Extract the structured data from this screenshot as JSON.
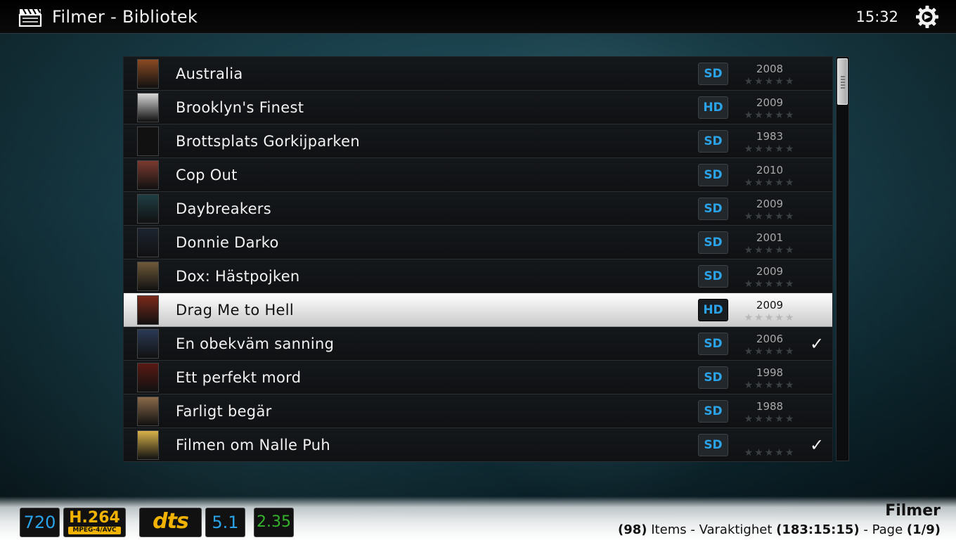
{
  "header": {
    "title": "Filmer - Bibliotek",
    "clock": "15:32",
    "icons": {
      "app": "clapperboard-icon",
      "settings": "gear-icon"
    }
  },
  "list": {
    "selected_index": 7,
    "items": [
      {
        "title": "Australia",
        "resolution": "SD",
        "year": "2008",
        "rating_stars": 0,
        "watched": false,
        "poster_color": "#8a4a22"
      },
      {
        "title": "Brooklyn's Finest",
        "resolution": "HD",
        "year": "2009",
        "rating_stars": 0,
        "watched": false,
        "poster_color": "#d8d8d8"
      },
      {
        "title": "Brottsplats Gorkijparken",
        "resolution": "SD",
        "year": "1983",
        "rating_stars": 0,
        "watched": false,
        "poster_color": "#111111"
      },
      {
        "title": "Cop Out",
        "resolution": "SD",
        "year": "2010",
        "rating_stars": 0,
        "watched": false,
        "poster_color": "#7a3a30"
      },
      {
        "title": "Daybreakers",
        "resolution": "SD",
        "year": "2009",
        "rating_stars": 0,
        "watched": false,
        "poster_color": "#1f3e44"
      },
      {
        "title": "Donnie Darko",
        "resolution": "SD",
        "year": "2001",
        "rating_stars": 0,
        "watched": false,
        "poster_color": "#1c2430"
      },
      {
        "title": "Dox: Hästpojken",
        "resolution": "SD",
        "year": "2009",
        "rating_stars": 0,
        "watched": false,
        "poster_color": "#6f5a3a"
      },
      {
        "title": "Drag Me to Hell",
        "resolution": "HD",
        "year": "2009",
        "rating_stars": 0,
        "watched": false,
        "poster_color": "#7b2a1a"
      },
      {
        "title": "En obekväm sanning",
        "resolution": "SD",
        "year": "2006",
        "rating_stars": 0,
        "watched": true,
        "poster_color": "#2a3a55"
      },
      {
        "title": "Ett perfekt mord",
        "resolution": "SD",
        "year": "1998",
        "rating_stars": 0,
        "watched": false,
        "poster_color": "#5a1a14"
      },
      {
        "title": "Farligt begär",
        "resolution": "SD",
        "year": "1988",
        "rating_stars": 0,
        "watched": false,
        "poster_color": "#8a6a4a"
      },
      {
        "title": "Filmen om Nalle Puh",
        "resolution": "SD",
        "year": "",
        "rating_stars": 0,
        "watched": true,
        "poster_color": "#d9b24a"
      }
    ]
  },
  "scrollbar": {
    "position_fraction": 0.0
  },
  "footer": {
    "media_flags": {
      "video_resolution": "720",
      "video_codec": "H.264",
      "video_codec_sub": "MPEG-4/AVC",
      "audio_codec": "dts",
      "audio_channels": "5.1",
      "aspect_ratio": "2.35"
    },
    "title": "Filmer",
    "items_count": "(98)",
    "items_label": "Items",
    "duration_label": "Varaktighet",
    "duration": "(183:15:15)",
    "page_label": "Page",
    "page": "(1/9)"
  },
  "colors": {
    "accent_blue": "#2aa3e8",
    "flag_gold": "#f2b300",
    "flag_green": "#34b32a"
  }
}
